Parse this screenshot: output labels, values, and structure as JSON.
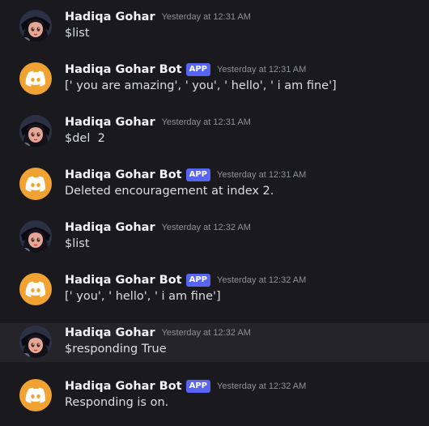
{
  "messages": [
    {
      "author": "Hadiqa Gohar",
      "is_bot": false,
      "timestamp": "Yesterday at 12:31 AM",
      "content": "$list",
      "highlighted": false
    },
    {
      "author": "Hadiqa Gohar Bot",
      "is_bot": true,
      "badge": "APP",
      "timestamp": "Yesterday at 12:31 AM",
      "content": "[' you are amazing', ' you', ' hello', ' i am fine']",
      "highlighted": false
    },
    {
      "author": "Hadiqa Gohar",
      "is_bot": false,
      "timestamp": "Yesterday at 12:31 AM",
      "content": "$del  2",
      "highlighted": false
    },
    {
      "author": "Hadiqa Gohar Bot",
      "is_bot": true,
      "badge": "APP",
      "timestamp": "Yesterday at 12:31 AM",
      "content": "Deleted encouragement at index 2.",
      "highlighted": false
    },
    {
      "author": "Hadiqa Gohar",
      "is_bot": false,
      "timestamp": "Yesterday at 12:32 AM",
      "content": "$list",
      "highlighted": false
    },
    {
      "author": "Hadiqa Gohar Bot",
      "is_bot": true,
      "badge": "APP",
      "timestamp": "Yesterday at 12:32 AM",
      "content": "[' you', ' hello', ' i am fine']",
      "highlighted": false
    },
    {
      "author": "Hadiqa Gohar",
      "is_bot": false,
      "timestamp": "Yesterday at 12:32 AM",
      "content": "$responding True",
      "highlighted": true
    },
    {
      "author": "Hadiqa Gohar Bot",
      "is_bot": true,
      "badge": "APP",
      "timestamp": "Yesterday at 12:32 AM",
      "content": "Responding is on.",
      "highlighted": false
    }
  ],
  "colors": {
    "background": "#1a1a1e",
    "highlight_row": "#242429",
    "bot_avatar": "#f0a232",
    "app_badge": "#5865f2"
  },
  "icons": {
    "bot_avatar": "discord-logo-icon",
    "user_avatar": "user-avatar-icon"
  }
}
